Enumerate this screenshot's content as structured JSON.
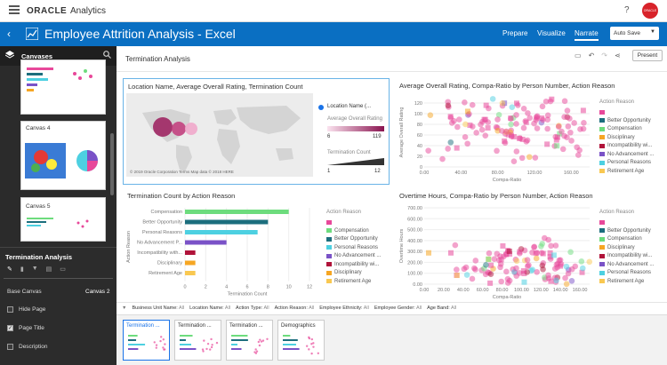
{
  "header": {
    "brand": "ORACLE",
    "product": "Analytics",
    "help": "?",
    "avatar_text": "ORACLE"
  },
  "titlebar": {
    "title": "Employee Attrition Analysis - Excel",
    "nav": [
      "Prepare",
      "Visualize",
      "Narrate"
    ],
    "active_nav": "Narrate",
    "autosave": "Auto Save"
  },
  "sidebar": {
    "canvases_label": "Canvases",
    "canvas_items": [
      {
        "label": "Canvas 4"
      },
      {
        "label": "Canvas 5"
      }
    ],
    "props_title": "Termination Analysis",
    "base_canvas_label": "Base Canvas",
    "base_canvas_value": "Canvas 2",
    "checkboxes": [
      {
        "label": "Hide Page",
        "checked": false
      },
      {
        "label": "Page Title",
        "checked": true
      },
      {
        "label": "Description",
        "checked": false
      }
    ]
  },
  "main": {
    "page_title": "Termination Analysis",
    "present_label": "Present",
    "map_viz": {
      "title": "Location Name, Average Overall Rating, Termination Count",
      "legend_location": "Location Name (...",
      "legend_rating": "Average Overall Rating",
      "rating_min": "6",
      "rating_max": "119",
      "legend_count": "Termination Count",
      "count_min": "1",
      "count_max": "12",
      "attribution": "© 2019 Oracle Corporation  Terms  Map data © 2018 HERE"
    },
    "scatter1": {
      "title": "Average Overall Rating, Compa-Ratio by Person Number, Action Reason",
      "ylabel": "Average Overall Rating",
      "xlabel": "Compa-Ratio",
      "legend_title": "Action Reason"
    },
    "bar_viz": {
      "title": "Termination Count by Action Reason",
      "ylabel": "Action Reason",
      "xlabel": "Termination Count",
      "legend_title": "Action Reason"
    },
    "scatter2": {
      "title": "Overtime Hours, Compa-Ratio by Person Number, Action Reason",
      "ylabel": "Overtime Hours",
      "xlabel": "Compa-Ratio",
      "legend_title": "Action Reason"
    },
    "legend_items": [
      {
        "label": "",
        "color": "#e8489a"
      },
      {
        "label": "Better Opportunity",
        "color": "#1c6e7d"
      },
      {
        "label": "Compensation",
        "color": "#6ddc7d"
      },
      {
        "label": "Disciplinary",
        "color": "#f6a623"
      },
      {
        "label": "Incompatibility wi...",
        "color": "#b0133a"
      },
      {
        "label": "No Advancement ...",
        "color": "#7a52c7"
      },
      {
        "label": "Personal Reasons",
        "color": "#4dd0e1"
      },
      {
        "label": "Retirement Age",
        "color": "#f9c851"
      }
    ],
    "bar_legend_items": [
      {
        "label": "",
        "color": "#e8489a"
      },
      {
        "label": "Compensation",
        "color": "#6ddc7d"
      },
      {
        "label": "Better Opportunity",
        "color": "#1c6e7d"
      },
      {
        "label": "Personal Reasons",
        "color": "#4dd0e1"
      },
      {
        "label": "No Advancement ...",
        "color": "#7a52c7"
      },
      {
        "label": "Incompatibility wi...",
        "color": "#b0133a"
      },
      {
        "label": "Disciplinary",
        "color": "#f6a623"
      },
      {
        "label": "Retirement Age",
        "color": "#f9c851"
      }
    ]
  },
  "filters": [
    {
      "name": "Business Unit Name:",
      "value": "All"
    },
    {
      "name": "Location Name:",
      "value": "All"
    },
    {
      "name": "Action Type:",
      "value": "All"
    },
    {
      "name": "Action Reason:",
      "value": "All"
    },
    {
      "name": "Employee Ethnicity:",
      "value": "All"
    },
    {
      "name": "Employee Gender:",
      "value": "All"
    },
    {
      "name": "Age Band:",
      "value": "All"
    }
  ],
  "story_pages": [
    {
      "label": "Termination ..."
    },
    {
      "label": "Termination ..."
    },
    {
      "label": "Termination ..."
    },
    {
      "label": "Demographics"
    }
  ],
  "chart_data": [
    {
      "type": "bar",
      "title": "Termination Count by Action Reason",
      "xlabel": "Termination Count",
      "ylabel": "Action Reason",
      "categories": [
        "Compensation",
        "Better Opportunity",
        "Personal Reasons",
        "No Advancement P...",
        "Incompatibility with...",
        "Disciplinary",
        "Retirement Age"
      ],
      "values": [
        10,
        8,
        7,
        4,
        1,
        1,
        1
      ],
      "colors": [
        "#6ddc7d",
        "#1c6e7d",
        "#4dd0e1",
        "#7a52c7",
        "#b0133a",
        "#f6a623",
        "#f9c851"
      ],
      "xticks": [
        "0",
        "2",
        "4",
        "6",
        "8",
        "10",
        "12"
      ],
      "xlim": [
        0,
        12
      ]
    },
    {
      "type": "scatter",
      "title": "Average Overall Rating, Compa-Ratio by Person Number, Action Reason",
      "xlabel": "Compa-Ratio",
      "ylabel": "Average Overall Rating",
      "xticks": [
        "0.00",
        "40.00",
        "80.00",
        "120.00",
        "160.00"
      ],
      "yticks": [
        "0",
        "20",
        "40",
        "60",
        "80",
        "100",
        "120"
      ],
      "xlim": [
        0,
        180
      ],
      "ylim": [
        0,
        130
      ]
    },
    {
      "type": "scatter",
      "title": "Overtime Hours, Compa-Ratio by Person Number, Action Reason",
      "xlabel": "Compa-Ratio",
      "ylabel": "Overtime Hours",
      "xticks": [
        "0.00",
        "20.00",
        "40.00",
        "60.00",
        "80.00",
        "100.00",
        "120.00",
        "140.00",
        "160.00"
      ],
      "yticks": [
        "0.00",
        "100.00",
        "200.00",
        "300.00",
        "400.00",
        "500.00",
        "600.00",
        "700.00"
      ],
      "xlim": [
        0,
        170
      ],
      "ylim": [
        0,
        700
      ]
    }
  ]
}
